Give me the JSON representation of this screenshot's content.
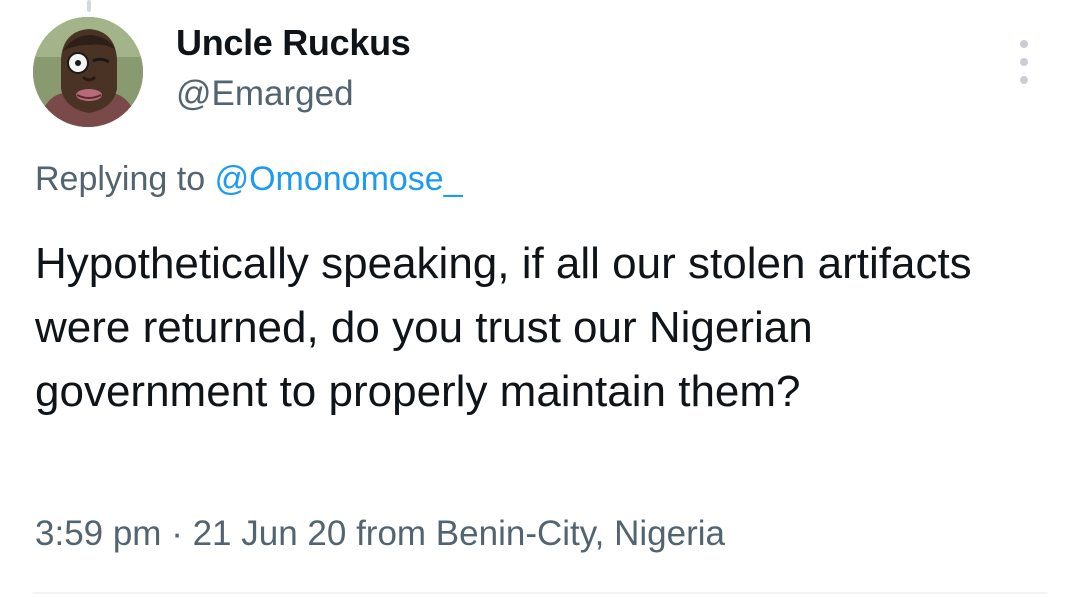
{
  "author": {
    "display_name": "Uncle Ruckus",
    "handle": "@Emarged",
    "avatar_icon": "cartoon-portrait-avatar"
  },
  "reply": {
    "prefix": "Replying to",
    "mention": "@Omonomose_"
  },
  "tweet": {
    "text": "Hypothetically speaking, if all our stolen artifacts were returned, do you trust our Nigerian government to properly maintain them?"
  },
  "meta": {
    "time": "3:59 pm",
    "separator": "·",
    "date": "21 Jun 20",
    "location": "from Benin-City, Nigeria"
  },
  "colors": {
    "text_primary": "#0f1419",
    "text_secondary": "#536471",
    "accent": "#1d9bf0"
  }
}
